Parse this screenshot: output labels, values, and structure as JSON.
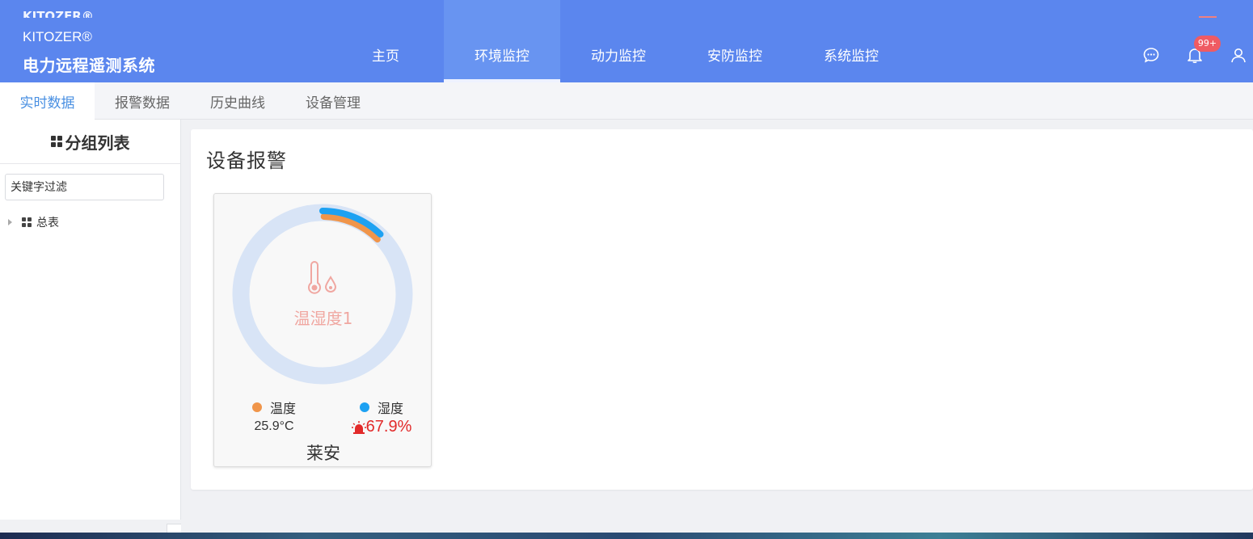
{
  "header": {
    "brand_top": "KITOZER®",
    "brand_mark": "KITOZER®",
    "brand_title": "电力远程遥测系统",
    "nav": [
      "主页",
      "环境监控",
      "动力监控",
      "安防监控",
      "系统监控"
    ],
    "nav_active": 1,
    "badge": "99+",
    "accent": "#5b86ee"
  },
  "subtabs": [
    {
      "label": "实时数据",
      "active": true
    },
    {
      "label": "报警数据",
      "active": false
    },
    {
      "label": "历史曲线",
      "active": false
    },
    {
      "label": "设备管理",
      "active": false
    }
  ],
  "sidebar": {
    "title": "分组列表",
    "filter_placeholder": "关键字过滤",
    "tree": [
      {
        "label": "总表"
      }
    ]
  },
  "main": {
    "title": "设备报警",
    "cards": [
      {
        "device": "温湿度1",
        "icon": "thermometer-humidity-icon",
        "metrics": [
          {
            "label": "温度",
            "value": "25.9°C",
            "color": "#f0954a",
            "alarm": false
          },
          {
            "label": "湿度",
            "value": "67.9%",
            "color": "#1da1f2",
            "alarm": true
          }
        ],
        "location": "莱安"
      }
    ]
  }
}
